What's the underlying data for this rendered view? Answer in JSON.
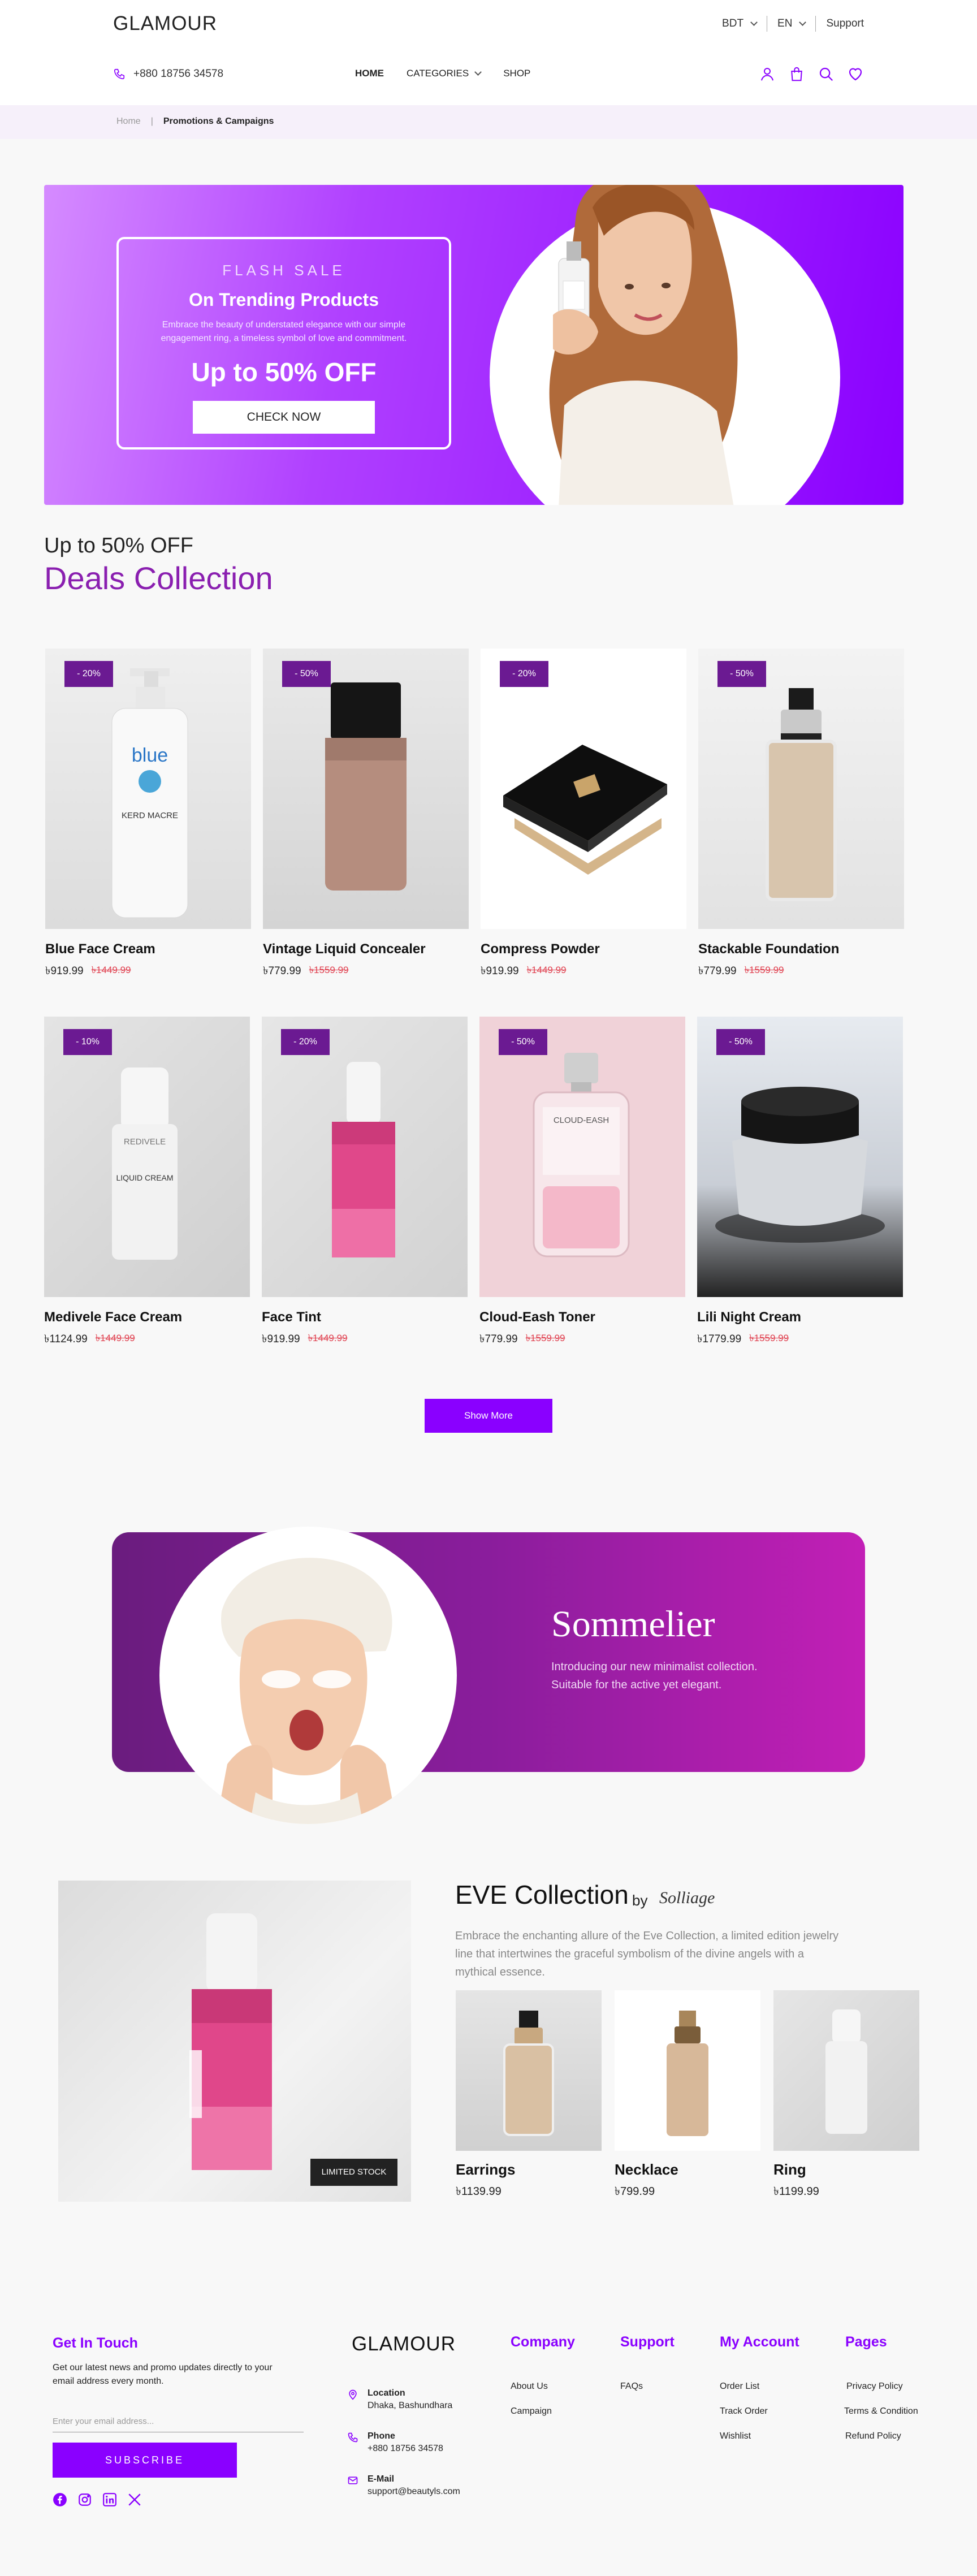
{
  "header": {
    "logo": "GLAMOUR",
    "currency": "BDT",
    "language": "EN",
    "support": "Support",
    "phone": "+880 18756 34578",
    "nav": [
      "HOME",
      "CATEGORIES",
      "SHOP"
    ]
  },
  "breadcrumb": {
    "home": "Home",
    "separator": "|",
    "current": "Promotions & Campaigns"
  },
  "hero": {
    "eyebrow": "FLASH SALE",
    "title": "On Trending Products",
    "description": "Embrace the beauty of understated elegance with our simple engagement ring, a timeless symbol of love and commitment.",
    "offer": "Up to 50% OFF",
    "button": "CHECK NOW"
  },
  "deals": {
    "subtitle": "Up to 50% OFF",
    "title": "Deals Collection",
    "products": [
      {
        "name": "Blue Face Cream",
        "price": "৳919.99",
        "old_price": "৳1449.99",
        "badge": "- 20%"
      },
      {
        "name": "Vintage Liquid Concealer",
        "price": "৳779.99",
        "old_price": "৳1559.99",
        "badge": "- 50%"
      },
      {
        "name": "Compress Powder",
        "price": "৳919.99",
        "old_price": "৳1449.99",
        "badge": "- 20%"
      },
      {
        "name": "Stackable Foundation",
        "price": "৳779.99",
        "old_price": "৳1559.99",
        "badge": "- 50%"
      },
      {
        "name": "Medivele Face Cream",
        "price": "৳1124.99",
        "old_price": "৳1449.99",
        "badge": "- 10%"
      },
      {
        "name": "Face Tint",
        "price": "৳919.99",
        "old_price": "৳1449.99",
        "badge": "- 20%"
      },
      {
        "name": "Cloud-Eash  Toner",
        "price": "৳779.99",
        "old_price": "৳1559.99",
        "badge": "- 50%"
      },
      {
        "name": "Lili Night Cream",
        "price": "৳1779.99",
        "old_price": "৳1559.99",
        "badge": "- 50%"
      }
    ],
    "show_more": "Show More"
  },
  "sommelier": {
    "title": "Sommelier",
    "description": "Introducing our new minimalist collection. Suitable for the active yet elegant."
  },
  "eve": {
    "title": "EVE Collection",
    "by": "by",
    "brand": "Solliage",
    "description": "Embrace the enchanting allure of the Eve Collection, a limited edition jewelry line that intertwines the graceful symbolism of the divine angels with a mythical essence.",
    "badge": "LIMITED STOCK",
    "items": [
      {
        "name": "Earrings",
        "price": "৳1139.99"
      },
      {
        "name": "Necklace",
        "price": "৳799.99"
      },
      {
        "name": "Ring",
        "price": "৳1199.99"
      }
    ]
  },
  "footer": {
    "get_in_touch": "Get In Touch",
    "newsletter_text": "Get our latest news and promo updates directly to your email address every month.",
    "email_placeholder": "Enter your email address...",
    "subscribe": "SUBSCRIBE",
    "logo": "GLAMOUR",
    "location_label": "Location",
    "location_value": "Dhaka, Bashundhara",
    "phone_label": "Phone",
    "phone_value": "+880 18756 34578",
    "email_label": "E-Mail",
    "email_value": "support@beautyls.com",
    "company": {
      "title": "Company",
      "links": [
        "About Us",
        "Campaign"
      ]
    },
    "support": {
      "title": "Support",
      "links": [
        "FAQs"
      ]
    },
    "account": {
      "title": "My Account",
      "links": [
        "Order List",
        "Track Order",
        "Wishlist"
      ]
    },
    "pages": {
      "title": "Pages",
      "links": [
        "Privacy Policy",
        "Terms & Condition",
        "Refund Policy"
      ]
    }
  },
  "colors": {
    "accent": "#8a00ff",
    "deep_purple": "#6b1a92",
    "title_purple": "#8a1fb0",
    "sale_red": "#e0404f"
  }
}
